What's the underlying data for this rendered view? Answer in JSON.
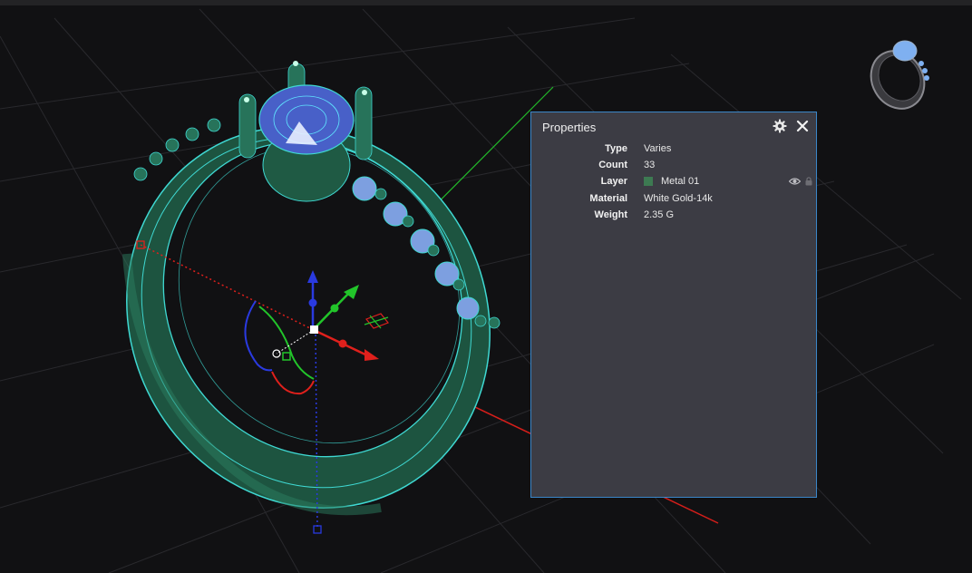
{
  "properties_panel": {
    "title": "Properties",
    "rows": [
      {
        "label": "Type",
        "value": "Varies"
      },
      {
        "label": "Count",
        "value": "33"
      },
      {
        "label": "Layer",
        "value": "Metal 01"
      },
      {
        "label": "Material",
        "value": "White Gold-14k"
      },
      {
        "label": "Weight",
        "value": "2.35 G"
      }
    ],
    "layer_color": "#3d7a52",
    "accent_color": "#3a86c8",
    "icons": [
      "gear-icon",
      "close-icon",
      "eye-icon",
      "lock-icon"
    ]
  },
  "viewport": {
    "background": "#111113",
    "grid_color": "#2a2a2e",
    "axis_colors": {
      "x": "#e0201c",
      "y": "#22c52a",
      "z": "#2a3ae0"
    },
    "model_wire_color": "#3fd8d2",
    "model_fill_color": "#1f5a44"
  }
}
